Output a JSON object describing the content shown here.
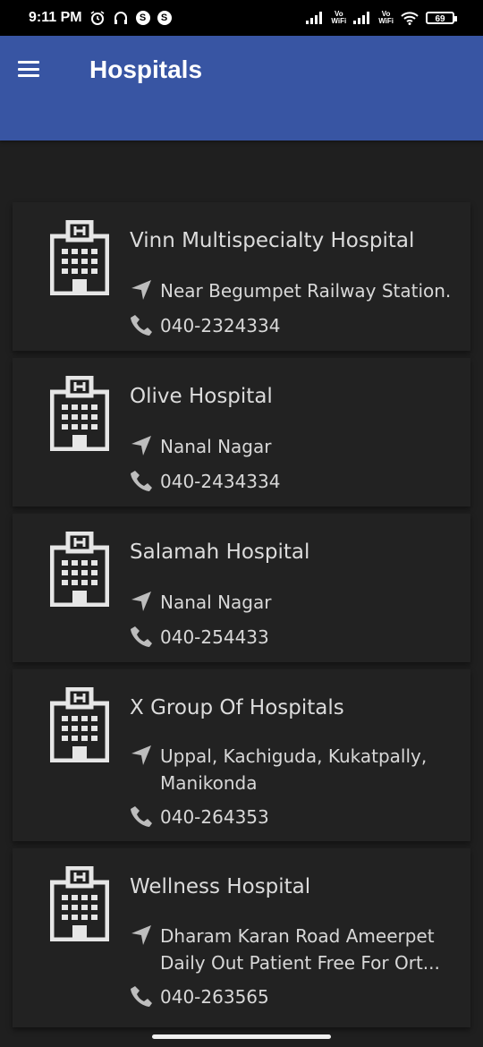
{
  "status_bar": {
    "time": "9:11 PM",
    "vo_1": "Vo",
    "wifi_1": "WiFi",
    "vo_2": "Vo",
    "wifi_2": "WiFi",
    "battery": "69"
  },
  "app_bar": {
    "title": "Hospitals"
  },
  "hospitals": [
    {
      "name": "Vinn Multispecialty Hospital",
      "address": "Near Begumpet Railway Station.",
      "phone": "040-2324334"
    },
    {
      "name": "Olive Hospital",
      "address": "Nanal Nagar",
      "phone": "040-2434334"
    },
    {
      "name": "Salamah Hospital",
      "address": "Nanal Nagar",
      "phone": "040-254433"
    },
    {
      "name": "X Group Of Hospitals",
      "address": "Uppal, Kachiguda, Kukatpally, Manikonda",
      "phone": "040-264353"
    },
    {
      "name": "Wellness Hospital",
      "address": "Dharam Karan Road Ameerpet Daily Out Patient Free For Ort...",
      "phone": "040-263565"
    }
  ]
}
